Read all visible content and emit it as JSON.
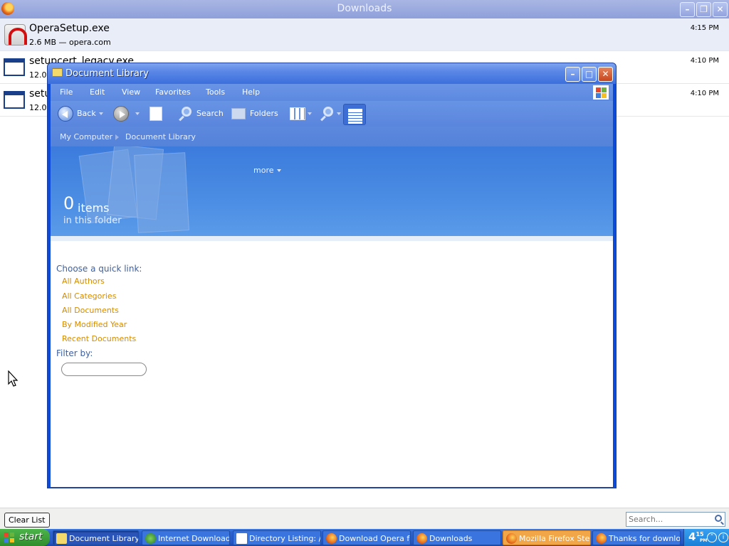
{
  "downloads": {
    "title": "Downloads",
    "items": [
      {
        "name": "OperaSetup.exe",
        "meta": "2.6 MB — opera.com",
        "time": "4:15 PM"
      },
      {
        "name": "setupcert_legacy.exe",
        "meta": "12.0",
        "time": "4:10 PM"
      },
      {
        "name": "setu",
        "meta": "12.0",
        "time": "4:10 PM"
      }
    ],
    "clear_label": "Clear List",
    "search_placeholder": "Search..."
  },
  "doc_window": {
    "title": "Document Library",
    "menu": [
      "File",
      "Edit",
      "View",
      "Favorites",
      "Tools",
      "Help"
    ],
    "toolbar": {
      "back": "Back",
      "search": "Search",
      "folders": "Folders"
    },
    "breadcrumb": [
      "My Computer",
      "Document Library"
    ],
    "header": {
      "more": "more",
      "count": "0",
      "count_unit": "items",
      "subtitle": "in this folder"
    },
    "quick_link_heading": "Choose a quick link:",
    "quick_links": [
      "All Authors",
      "All Categories",
      "All Documents",
      "By Modified Year",
      "Recent Documents"
    ],
    "filter_heading": "Filter by:"
  },
  "taskbar": {
    "start": "start",
    "tasks": [
      {
        "label": "Document Library",
        "state": "active"
      },
      {
        "label": "Internet Download I",
        "state": "normal"
      },
      {
        "label": "Directory Listing: /p",
        "state": "normal"
      },
      {
        "label": "Download Opera fo",
        "state": "normal"
      },
      {
        "label": "Downloads",
        "state": "normal"
      },
      {
        "label": "Mozilla Firefox Ster",
        "state": "warn"
      },
      {
        "label": "Thanks for downloa",
        "state": "normal"
      }
    ],
    "clock_hour": "4",
    "clock_min": "15",
    "clock_suffix": "PM"
  },
  "colors": {
    "xp_blue": "#0d4bd6",
    "link_orange": "#d48b00",
    "start_green": "#308d2c"
  },
  "icons": [
    "firefox-icon",
    "opera-icon",
    "exe-icon",
    "folder-icon",
    "windows-logo-icon",
    "back-arrow-icon",
    "forward-arrow-icon",
    "search-icon",
    "folders-icon",
    "views-icon",
    "calendar-icon"
  ]
}
